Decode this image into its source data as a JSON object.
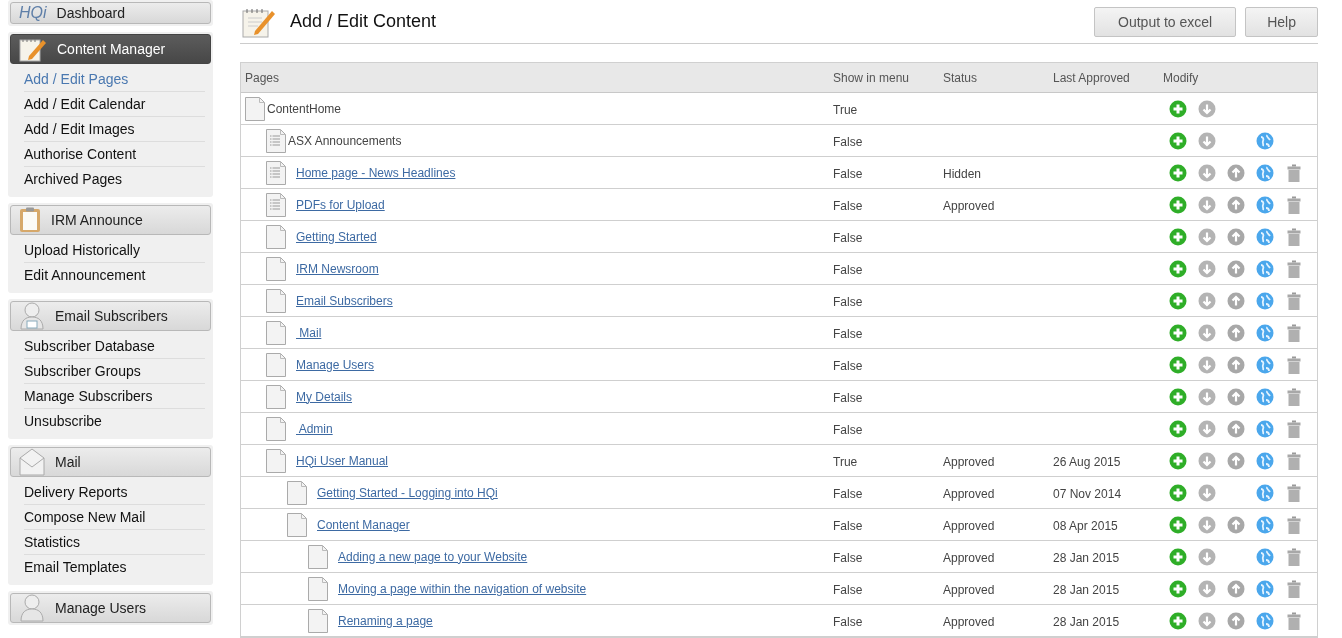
{
  "sidebar": {
    "groups": [
      {
        "logo": "HQi",
        "title": "Dashboard",
        "selected": false
      },
      {
        "title": "Content Manager",
        "selected": true,
        "items": [
          {
            "label": "Add / Edit Pages",
            "selected": true
          },
          {
            "label": "Add / Edit Calendar",
            "selected": false
          },
          {
            "label": "Add / Edit Images",
            "selected": false
          },
          {
            "label": "Authorise Content",
            "selected": false
          },
          {
            "label": "Archived Pages",
            "selected": false
          }
        ]
      },
      {
        "title": "IRM Announce",
        "selected": false,
        "items": [
          {
            "label": "Upload Historically",
            "selected": false
          },
          {
            "label": "Edit Announcement",
            "selected": false
          }
        ]
      },
      {
        "title": "Email Subscribers",
        "selected": false,
        "items": [
          {
            "label": "Subscriber Database",
            "selected": false
          },
          {
            "label": "Subscriber Groups",
            "selected": false
          },
          {
            "label": "Manage Subscribers",
            "selected": false
          },
          {
            "label": "Unsubscribe",
            "selected": false
          }
        ]
      },
      {
        "title": "Mail",
        "selected": false,
        "items": [
          {
            "label": "Delivery Reports",
            "selected": false
          },
          {
            "label": "Compose New Mail",
            "selected": false
          },
          {
            "label": "Statistics",
            "selected": false
          },
          {
            "label": "Email Templates",
            "selected": false
          }
        ]
      },
      {
        "title": "Manage Users",
        "selected": false
      }
    ]
  },
  "header": {
    "title": "Add / Edit Content",
    "buttons": [
      "Output to excel",
      "Help"
    ]
  },
  "table": {
    "columns": [
      "Pages",
      "Show in menu",
      "Status",
      "Last Approved",
      "Modify"
    ],
    "rows": [
      {
        "name": "ContentHome",
        "kind": "page",
        "link": false,
        "show_in_menu": "True",
        "add": true,
        "down": true,
        "up": false,
        "publish": false,
        "delete": false,
        "children": [
          {
            "name": "ASX Announcements",
            "kind": "list",
            "link": false,
            "show_in_menu": "False",
            "add": true,
            "down": true,
            "up": false,
            "publish": true,
            "delete": false
          },
          {
            "name": "Home page - News Headlines",
            "kind": "list",
            "link": true,
            "show_in_menu": "False",
            "status": "Hidden",
            "add": true,
            "down": true,
            "up": true,
            "publish": true,
            "delete": true
          },
          {
            "name": "PDFs for Upload",
            "kind": "list",
            "link": true,
            "show_in_menu": "False",
            "status": "Approved",
            "add": true,
            "down": true,
            "up": true,
            "publish": true,
            "delete": true
          },
          {
            "name": "Getting Started",
            "kind": "page",
            "link": true,
            "show_in_menu": "False",
            "add": true,
            "down": true,
            "up": true,
            "publish": true,
            "delete": true
          },
          {
            "name": "IRM Newsroom",
            "kind": "page",
            "link": true,
            "show_in_menu": "False",
            "add": true,
            "down": true,
            "up": true,
            "publish": true,
            "delete": true
          },
          {
            "name": "Email Subscribers",
            "kind": "page",
            "link": true,
            "show_in_menu": "False",
            "add": true,
            "down": true,
            "up": true,
            "publish": true,
            "delete": true
          },
          {
            "name": " Mail",
            "kind": "page",
            "link": true,
            "show_in_menu": "False",
            "add": true,
            "down": true,
            "up": true,
            "publish": true,
            "delete": true
          },
          {
            "name": "Manage Users",
            "kind": "page",
            "link": true,
            "show_in_menu": "False",
            "add": true,
            "down": true,
            "up": true,
            "publish": true,
            "delete": true
          },
          {
            "name": "My Details",
            "kind": "page",
            "link": true,
            "show_in_menu": "False",
            "add": true,
            "down": true,
            "up": true,
            "publish": true,
            "delete": true
          },
          {
            "name": " Admin",
            "kind": "page",
            "link": true,
            "show_in_menu": "False",
            "add": true,
            "down": true,
            "up": true,
            "publish": true,
            "delete": true
          },
          {
            "name": "HQi User Manual",
            "kind": "page",
            "link": true,
            "show_in_menu": "True",
            "status": "Approved",
            "last_approved": "26 Aug 2015",
            "add": true,
            "down": true,
            "up": true,
            "publish": true,
            "delete": true,
            "children": [
              {
                "name": "Getting Started - Logging into HQi",
                "kind": "page",
                "link": true,
                "show_in_menu": "False",
                "status": "Approved",
                "last_approved": "07 Nov 2014",
                "add": true,
                "down": true,
                "up": false,
                "publish": true,
                "delete": true
              },
              {
                "name": "Content Manager",
                "kind": "page",
                "link": true,
                "show_in_menu": "False",
                "status": "Approved",
                "last_approved": "08 Apr 2015",
                "add": true,
                "down": true,
                "up": true,
                "publish": true,
                "delete": true,
                "children": [
                  {
                    "name": "Adding a new page to your Website",
                    "kind": "page",
                    "link": true,
                    "show_in_menu": "False",
                    "status": "Approved",
                    "last_approved": "28 Jan 2015",
                    "add": true,
                    "down": true,
                    "up": false,
                    "publish": true,
                    "delete": true
                  },
                  {
                    "name": "Moving a page within the navigation of website",
                    "kind": "page",
                    "link": true,
                    "show_in_menu": "False",
                    "status": "Approved",
                    "last_approved": "28 Jan 2015",
                    "add": true,
                    "down": true,
                    "up": true,
                    "publish": true,
                    "delete": true
                  },
                  {
                    "name": "Renaming a page",
                    "kind": "page",
                    "link": true,
                    "show_in_menu": "False",
                    "status": "Approved",
                    "last_approved": "28 Jan 2015",
                    "add": true,
                    "down": true,
                    "up": true,
                    "publish": true,
                    "delete": true
                  }
                ]
              }
            ]
          }
        ]
      }
    ]
  }
}
